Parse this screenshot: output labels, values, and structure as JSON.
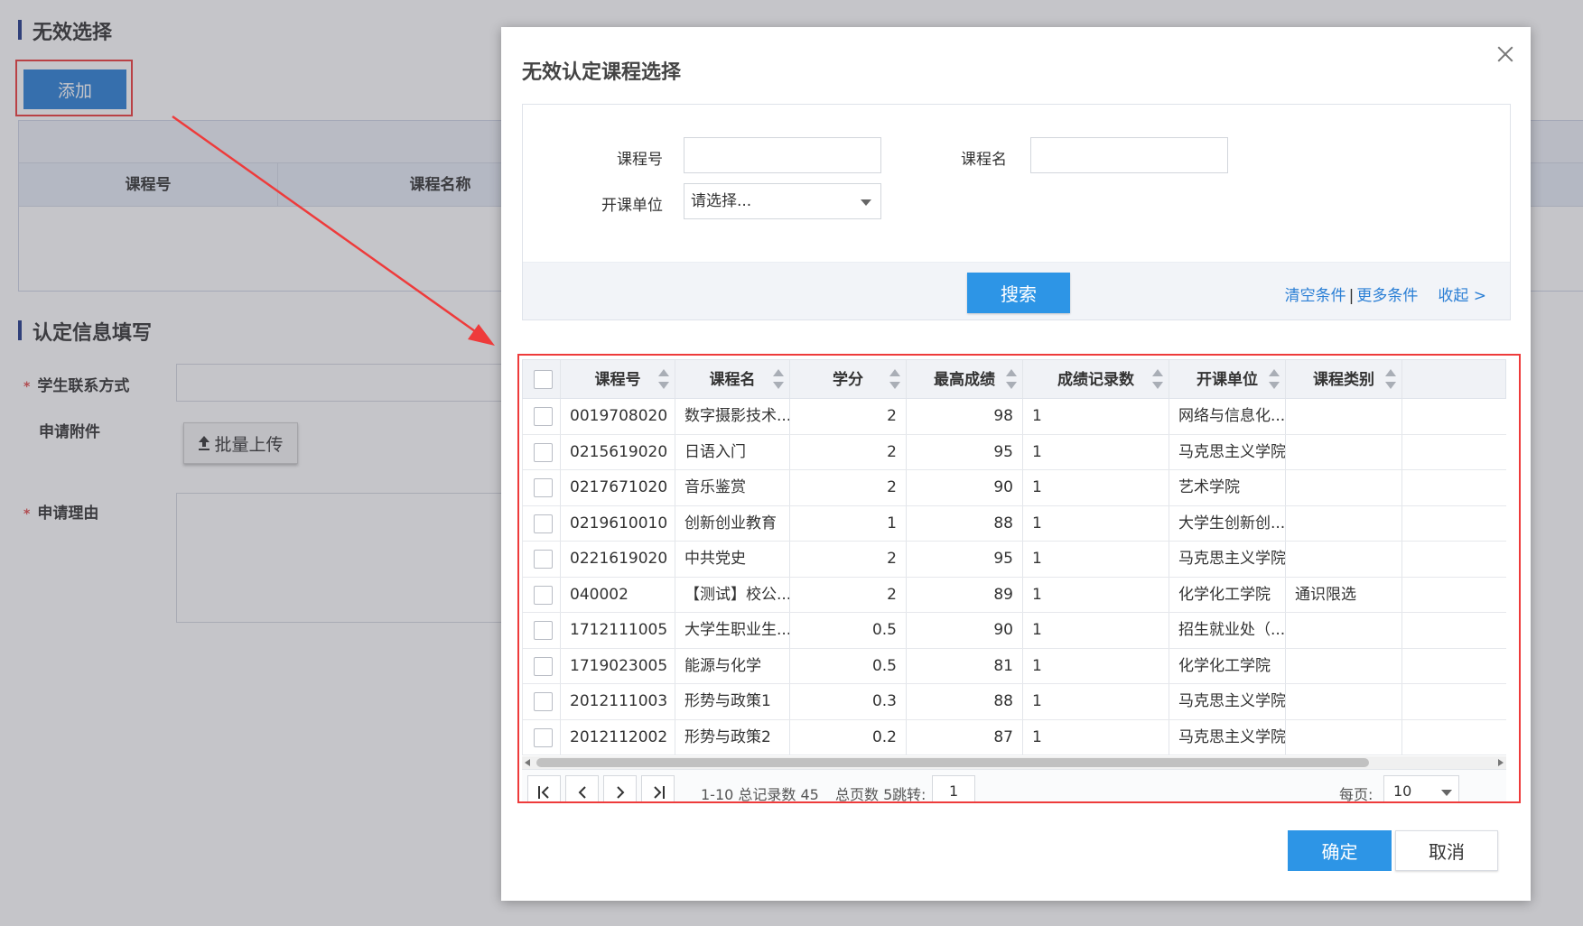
{
  "background": {
    "invalid_section_title": "无效选择",
    "add_button": "添加",
    "table_headers": [
      "课程号",
      "课程名称"
    ],
    "info_section_title": "认定信息填写",
    "contact_label": "学生联系方式",
    "attachment_label": "申请附件",
    "upload_button": "批量上传",
    "reason_label": "申请理由",
    "required_mark": "*"
  },
  "modal": {
    "title": "无效认定课程选择",
    "search": {
      "course_no_label": "课程号",
      "course_name_label": "课程名",
      "dept_label": "开课单位",
      "dept_selected": "请选择...",
      "search_button": "搜索",
      "clear_link": "清空条件",
      "separator": "|",
      "more_link": "更多条件",
      "collapse_link": "收起 >"
    },
    "grid": {
      "columns": [
        "课程号",
        "课程名",
        "学分",
        "最高成绩",
        "成绩记录数",
        "开课单位",
        "课程类别"
      ],
      "rows": [
        {
          "no": "0019708020",
          "name": "数字摄影技术...",
          "credit": "2",
          "score": "98",
          "count": "1",
          "dept": "网络与信息化...",
          "type": ""
        },
        {
          "no": "0215619020",
          "name": "日语入门",
          "credit": "2",
          "score": "95",
          "count": "1",
          "dept": "马克思主义学院",
          "type": ""
        },
        {
          "no": "0217671020",
          "name": "音乐鉴赏",
          "credit": "2",
          "score": "90",
          "count": "1",
          "dept": "艺术学院",
          "type": ""
        },
        {
          "no": "0219610010",
          "name": "创新创业教育",
          "credit": "1",
          "score": "88",
          "count": "1",
          "dept": "大学生创新创...",
          "type": ""
        },
        {
          "no": "0221619020",
          "name": "中共党史",
          "credit": "2",
          "score": "95",
          "count": "1",
          "dept": "马克思主义学院",
          "type": ""
        },
        {
          "no": "040002",
          "name": "【测试】校公...",
          "credit": "2",
          "score": "89",
          "count": "1",
          "dept": "化学化工学院",
          "type": "通识限选"
        },
        {
          "no": "1712111005",
          "name": "大学生职业生...",
          "credit": "0.5",
          "score": "90",
          "count": "1",
          "dept": "招生就业处（...",
          "type": ""
        },
        {
          "no": "1719023005",
          "name": "能源与化学",
          "credit": "0.5",
          "score": "81",
          "count": "1",
          "dept": "化学化工学院",
          "type": ""
        },
        {
          "no": "2012111003",
          "name": "形势与政策1",
          "credit": "0.3",
          "score": "88",
          "count": "1",
          "dept": "马克思主义学院",
          "type": ""
        },
        {
          "no": "2012112002",
          "name": "形势与政策2",
          "credit": "0.2",
          "score": "87",
          "count": "1",
          "dept": "马克思主义学院",
          "type": ""
        }
      ]
    },
    "pager": {
      "records_text": "1-10 总记录数 45",
      "pages_text": "总页数 5",
      "jump_label": "跳转:",
      "jump_value": "1",
      "per_page_label": "每页:",
      "per_page_value": "10"
    },
    "ok_button": "确定",
    "cancel_button": "取消"
  },
  "colors": {
    "primary": "#2d95e6",
    "annotation": "#ee3b3b",
    "section_bar": "#223a8a"
  }
}
